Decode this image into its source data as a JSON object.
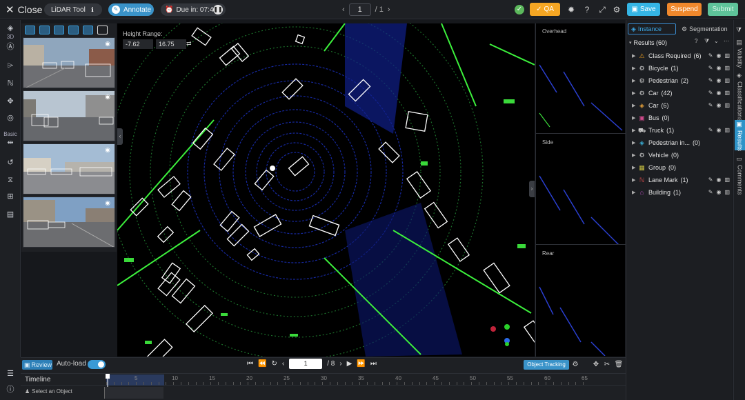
{
  "topbar": {
    "close_label": "Close",
    "tool_name": "LiDAR Tool",
    "annotate_label": "Annotate",
    "due_label": "Due in: 07:49",
    "page_current": "1",
    "page_total": "/ 1",
    "qa_label": "QA",
    "save_label": "Save",
    "suspend_label": "Suspend",
    "submit_label": "Submit"
  },
  "lefttools": {
    "label_3d": "3D",
    "label_basic": "Basic"
  },
  "viewport": {
    "height_range_label": "Height Range:",
    "height_min": "-7.62",
    "height_max": "16.75"
  },
  "sideviews": {
    "overhead": "Overhead",
    "side": "Side",
    "rear": "Rear"
  },
  "rightpanel": {
    "tab_instance": "Instance",
    "tab_segmentation": "Segmentation",
    "results_label": "Results (60)",
    "classes": [
      {
        "name": "Class Required",
        "count": "(6)",
        "icon": "warning-icon",
        "color": "#f0a020",
        "actions": true
      },
      {
        "name": "Bicycle",
        "count": "(1)",
        "icon": "bicycle-icon",
        "color": "#c8c8c8",
        "actions": true
      },
      {
        "name": "Pedestrian",
        "count": "(2)",
        "icon": "pedestrian-icon",
        "color": "#c8c8c8",
        "actions": true
      },
      {
        "name": "Car",
        "count": "(42)",
        "icon": "car-icon",
        "color": "#c8c8c8",
        "actions": true
      },
      {
        "name": "Car",
        "count": "(6)",
        "icon": "cube-icon",
        "color": "#e8a33a",
        "actions": true
      },
      {
        "name": "Bus",
        "count": "(0)",
        "icon": "bus-icon",
        "color": "#d04a8c",
        "actions": false
      },
      {
        "name": "Truck",
        "count": "(1)",
        "icon": "truck-icon",
        "color": "#c8c8c8",
        "actions": true
      },
      {
        "name": "Pedestrian in...",
        "count": "(0)",
        "icon": "cube-icon",
        "color": "#3ab0d8",
        "actions": false
      },
      {
        "name": "Vehicle",
        "count": "(0)",
        "icon": "vehicle-icon",
        "color": "#c8c8c8",
        "actions": false
      },
      {
        "name": "Group",
        "count": "(0)",
        "icon": "group-icon",
        "color": "#c8c040",
        "actions": false
      },
      {
        "name": "Lane Mark",
        "count": "(1)",
        "icon": "lane-icon",
        "color": "#d04a4a",
        "actions": true
      },
      {
        "name": "Building",
        "count": "(1)",
        "icon": "building-icon",
        "color": "#c050c8",
        "actions": true
      }
    ]
  },
  "farright": {
    "tab_validity": "Validity",
    "tab_classifications": "Classifications",
    "tab_results": "Results",
    "tab_comments": "Comments"
  },
  "bottombar": {
    "review_label": "Review",
    "autoload_label": "Auto-load",
    "frame_current": "1",
    "frame_total": "/ 8",
    "tracking_label": "Object Tracking",
    "timeline_label": "Timeline",
    "select_label": "Select an Object",
    "ticks": [
      "5",
      "10",
      "15",
      "20",
      "25",
      "30",
      "35",
      "40",
      "45",
      "50",
      "55",
      "60",
      "65"
    ]
  },
  "colors": {
    "accent": "#3a93c9",
    "qa": "#f5a623",
    "save": "#35b5e5",
    "suspend": "#f0882c",
    "submit": "#5ec39a"
  }
}
